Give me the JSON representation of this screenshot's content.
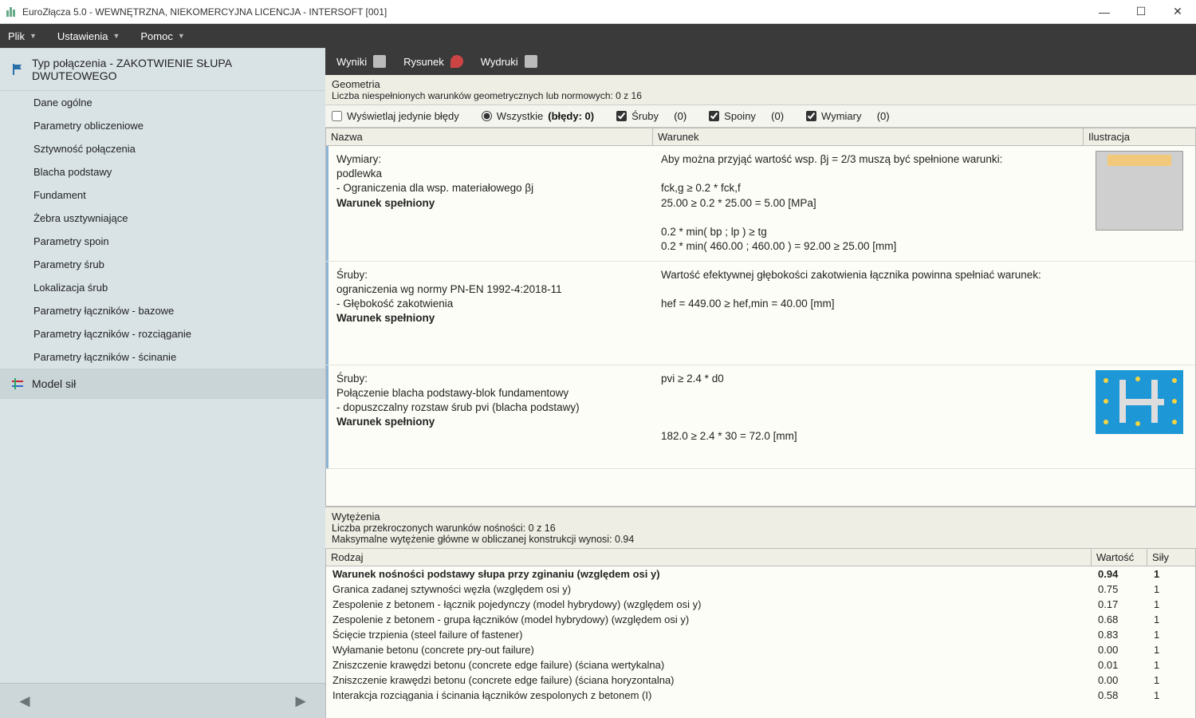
{
  "window": {
    "title": "EuroZłącza 5.0 - WEWNĘTRZNA, NIEKOMERCYJNA LICENCJA - INTERSOFT [001]"
  },
  "menu": {
    "plik": "Plik",
    "ustawienia": "Ustawienia",
    "pomoc": "Pomoc"
  },
  "sidebar": {
    "section1": {
      "label": "Typ połączenia - ZAKOTWIENIE SŁUPA DWUTEOWEGO"
    },
    "items": [
      "Dane ogólne",
      "Parametry obliczeniowe",
      "Sztywność połączenia",
      "Blacha podstawy",
      "Fundament",
      "Żebra usztywniające",
      "Parametry spoin",
      "Parametry śrub",
      "Lokalizacja śrub",
      "Parametry łączników - bazowe",
      "Parametry łączników - rozciąganie",
      "Parametry łączników - ścinanie"
    ],
    "section2": {
      "label": "Model sił"
    }
  },
  "toolbar": {
    "wyniki": "Wyniki",
    "rysunek": "Rysunek",
    "wydruki": "Wydruki"
  },
  "geom": {
    "heading": "Geometria",
    "subtitle": "Liczba niespełnionych warunków geometrycznych lub normowych: 0 z 16",
    "filters": {
      "errorsOnly": "Wyświetlaj jedynie błędy",
      "wszystkie": "Wszystkie",
      "bledy": "(błędy: 0)",
      "sruby": "Śruby",
      "srubyCount": "(0)",
      "spoiny": "Spoiny",
      "spoinyCount": "(0)",
      "wymiary": "Wymiary",
      "wymiaryCount": "(0)"
    },
    "cols": {
      "nazwa": "Nazwa",
      "warunek": "Warunek",
      "ilustr": "Ilustracja"
    },
    "rows": [
      {
        "nazwa": "Wymiary:\npodlewka\n- Ograniczenia dla wsp. materiałowego βj",
        "status": "Warunek spełniony",
        "warunek": "Aby można przyjąć wartość wsp. βj = 2/3 muszą być spełnione warunki:\n\nfck,g ≥ 0.2 * fck,f\n25.00 ≥ 0.2 * 25.00 = 5.00 [MPa]\n\n0.2 * min( bp  ;  lp ) ≥ tg\n0.2 * min( 460.00  ;  460.00 ) = 92.00 ≥ 25.00 [mm]",
        "illus": "block"
      },
      {
        "nazwa": "Śruby:\nograniczenia wg normy PN-EN 1992-4:2018-11\n- Głębokość zakotwienia",
        "status": "Warunek spełniony",
        "warunek": "Wartość efektywnej głębokości zakotwienia łącznika powinna spełniać warunek:\n\nhef = 449.00 ≥ hef,min = 40.00 [mm]",
        "illus": ""
      },
      {
        "nazwa": "Śruby:\nPołączenie blacha podstawy-blok fundamentowy\n- dopuszczalny rozstaw śrub pvi (blacha podstawy)",
        "status": "Warunek spełniony",
        "warunek": "pvi ≥ 2.4 * d0\n\n\n\n182.0 ≥ 2.4 * 30 = 72.0 [mm]",
        "illus": "plate"
      }
    ]
  },
  "wyt": {
    "heading": "Wytężenia",
    "line1": "Liczba przekroczonych warunków nośności: 0 z 16",
    "line2": "Maksymalne wytężenie główne w obliczanej konstrukcji wynosi: 0.94",
    "cols": {
      "rodzaj": "Rodzaj",
      "wartosc": "Wartość",
      "sily": "Siły"
    },
    "rows": [
      {
        "rodzaj": "Warunek nośności podstawy słupa przy zginaniu (względem osi y)",
        "wartosc": "0.94",
        "sily": "1",
        "bold": true
      },
      {
        "rodzaj": "Granica zadanej sztywności węzła (względem osi y)",
        "wartosc": "0.75",
        "sily": "1"
      },
      {
        "rodzaj": "Zespolenie z betonem - łącznik pojedynczy (model hybrydowy) (względem osi y)",
        "wartosc": "0.17",
        "sily": "1"
      },
      {
        "rodzaj": "Zespolenie z betonem - grupa łączników (model hybrydowy) (względem osi y)",
        "wartosc": "0.68",
        "sily": "1"
      },
      {
        "rodzaj": "Ścięcie trzpienia (steel failure of fastener)",
        "wartosc": "0.83",
        "sily": "1"
      },
      {
        "rodzaj": "Wyłamanie betonu (concrete pry-out failure)",
        "wartosc": "0.00",
        "sily": "1"
      },
      {
        "rodzaj": "Zniszczenie krawędzi betonu (concrete edge failure) (ściana wertykalna)",
        "wartosc": "0.01",
        "sily": "1"
      },
      {
        "rodzaj": "Zniszczenie krawędzi betonu (concrete edge failure) (ściana horyzontalna)",
        "wartosc": "0.00",
        "sily": "1"
      },
      {
        "rodzaj": "Interakcja rozciągania i ścinania łączników zespolonych z betonem (I)",
        "wartosc": "0.58",
        "sily": "1"
      }
    ]
  }
}
